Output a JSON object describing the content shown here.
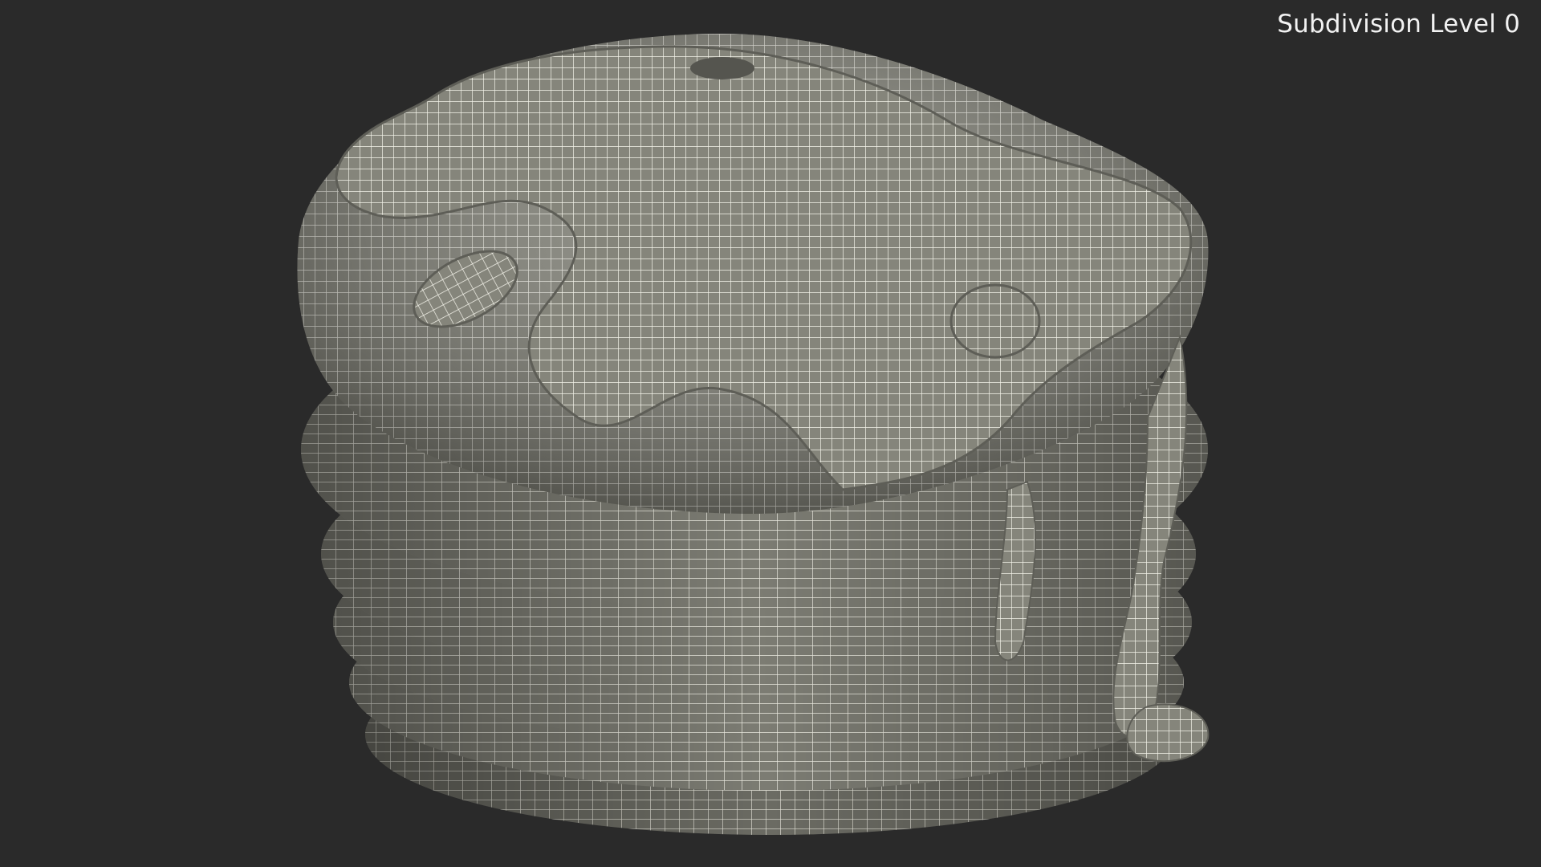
{
  "viewport": {
    "overlay_label": "Subdivision Level 0",
    "background_color": "#2a2a2a",
    "model_shading": "clay-wireframe",
    "model_base_color": "#8f8f85",
    "wire_color": "#f4f3ea"
  },
  "model": {
    "subject": "pancake-stack-with-syrup",
    "layers": 5
  }
}
